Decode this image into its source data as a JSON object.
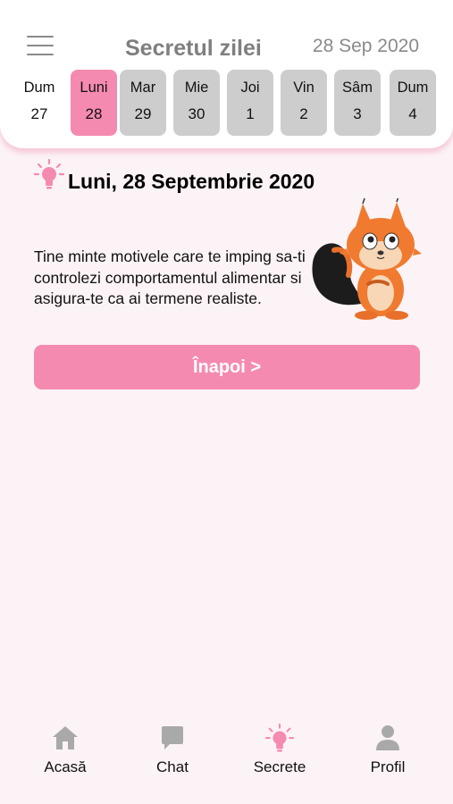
{
  "header": {
    "title": "Secretul zilei",
    "date": "28 Sep 2020",
    "menu_icon": "hamburger-menu-icon"
  },
  "days": [
    {
      "name": "Dum",
      "num": "27",
      "state": "plain"
    },
    {
      "name": "Luni",
      "num": "28",
      "state": "selected"
    },
    {
      "name": "Mar",
      "num": "29",
      "state": "default"
    },
    {
      "name": "Mie",
      "num": "30",
      "state": "default"
    },
    {
      "name": "Joi",
      "num": "1",
      "state": "default"
    },
    {
      "name": "Vin",
      "num": "2",
      "state": "default"
    },
    {
      "name": "Sâm",
      "num": "3",
      "state": "default"
    },
    {
      "name": "Dum",
      "num": "4",
      "state": "default"
    }
  ],
  "content": {
    "day_title": "Luni, 28 Septembrie 2020",
    "tip": "Tine minte motivele care te imping sa-ti controlezi comportamentul alimentar si asigura-te ca ai termene realiste.",
    "back_label": "Înapoi >"
  },
  "tabs": [
    {
      "label": "Acasă",
      "icon": "home-icon"
    },
    {
      "label": "Chat",
      "icon": "chat-icon"
    },
    {
      "label": "Secrete",
      "icon": "lightbulb-icon",
      "active": true
    },
    {
      "label": "Profil",
      "icon": "profile-icon"
    }
  ],
  "colors": {
    "accent": "#f58ab0",
    "background": "#fcf3f6",
    "day_default": "#cdcdcd",
    "tab_icon_inactive": "#a9a9a9"
  }
}
